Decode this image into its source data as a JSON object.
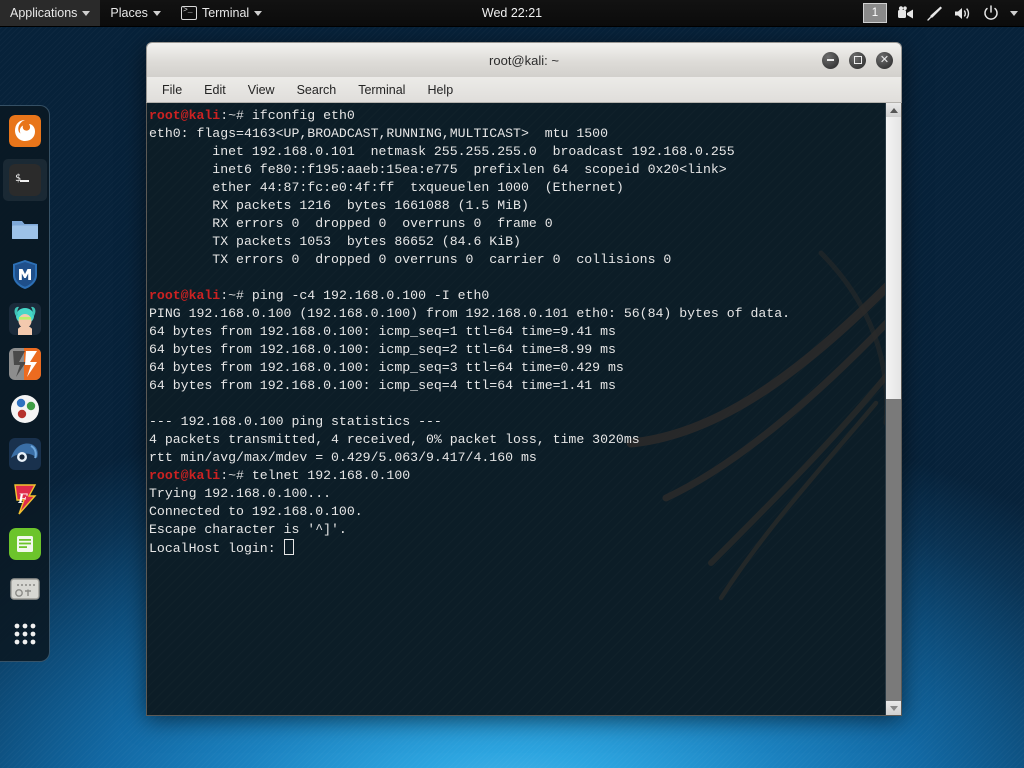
{
  "panel": {
    "applications_label": "Applications",
    "places_label": "Places",
    "terminal_label": "Terminal",
    "clock": "Wed 22:21",
    "workspace": "1",
    "tray": [
      {
        "name": "video-camera-icon"
      },
      {
        "name": "pen-icon"
      },
      {
        "name": "volume-icon"
      },
      {
        "name": "power-icon"
      },
      {
        "name": "chevron-down-icon"
      }
    ]
  },
  "dock": {
    "items": [
      {
        "name": "firefox-icon",
        "label": "Firefox ESR",
        "active": false
      },
      {
        "name": "terminal-icon",
        "label": "Terminal",
        "active": true
      },
      {
        "name": "files-icon",
        "label": "Files",
        "active": false
      },
      {
        "name": "metasploit-icon",
        "label": "Metasploit Framework",
        "active": false
      },
      {
        "name": "armitage-icon",
        "label": "Armitage",
        "active": false
      },
      {
        "name": "burpsuite-icon",
        "label": "Burp Suite",
        "active": false
      },
      {
        "name": "beef-icon",
        "label": "BeEF",
        "active": false
      },
      {
        "name": "maltego-icon",
        "label": "Maltego",
        "active": false
      },
      {
        "name": "faraday-icon",
        "label": "Faraday IDE",
        "active": false
      },
      {
        "name": "text-editor-icon",
        "label": "Text Editor",
        "active": false
      },
      {
        "name": "cherrytree-icon",
        "label": "CherryTree",
        "active": false
      },
      {
        "name": "show-applications-icon",
        "label": "Show Applications",
        "active": false
      }
    ]
  },
  "window": {
    "title": "root@kali: ~",
    "controls": {
      "minimize": "minimize",
      "maximize": "maximize",
      "close": "close"
    },
    "menu": [
      "File",
      "Edit",
      "View",
      "Search",
      "Terminal",
      "Help"
    ]
  },
  "terminal": {
    "prompt_user": "root@kali",
    "prompt_path": ":~# ",
    "colors": {
      "background": "#0c1d27",
      "foreground": "#e6e6e6",
      "prompt_red": "#cc2222"
    },
    "lines": [
      {
        "type": "prompt",
        "command": "ifconfig eth0"
      },
      {
        "type": "out",
        "text": "eth0: flags=4163<UP,BROADCAST,RUNNING,MULTICAST>  mtu 1500"
      },
      {
        "type": "out",
        "text": "        inet 192.168.0.101  netmask 255.255.255.0  broadcast 192.168.0.255"
      },
      {
        "type": "out",
        "text": "        inet6 fe80::f195:aaeb:15ea:e775  prefixlen 64  scopeid 0x20<link>"
      },
      {
        "type": "out",
        "text": "        ether 44:87:fc:e0:4f:ff  txqueuelen 1000  (Ethernet)"
      },
      {
        "type": "out",
        "text": "        RX packets 1216  bytes 1661088 (1.5 MiB)"
      },
      {
        "type": "out",
        "text": "        RX errors 0  dropped 0  overruns 0  frame 0"
      },
      {
        "type": "out",
        "text": "        TX packets 1053  bytes 86652 (84.6 KiB)"
      },
      {
        "type": "out",
        "text": "        TX errors 0  dropped 0 overruns 0  carrier 0  collisions 0"
      },
      {
        "type": "out",
        "text": ""
      },
      {
        "type": "prompt",
        "command": "ping -c4 192.168.0.100 -I eth0"
      },
      {
        "type": "out",
        "text": "PING 192.168.0.100 (192.168.0.100) from 192.168.0.101 eth0: 56(84) bytes of data."
      },
      {
        "type": "out",
        "text": "64 bytes from 192.168.0.100: icmp_seq=1 ttl=64 time=9.41 ms"
      },
      {
        "type": "out",
        "text": "64 bytes from 192.168.0.100: icmp_seq=2 ttl=64 time=8.99 ms"
      },
      {
        "type": "out",
        "text": "64 bytes from 192.168.0.100: icmp_seq=3 ttl=64 time=0.429 ms"
      },
      {
        "type": "out",
        "text": "64 bytes from 192.168.0.100: icmp_seq=4 ttl=64 time=1.41 ms"
      },
      {
        "type": "out",
        "text": ""
      },
      {
        "type": "out",
        "text": "--- 192.168.0.100 ping statistics ---"
      },
      {
        "type": "out",
        "text": "4 packets transmitted, 4 received, 0% packet loss, time 3020ms"
      },
      {
        "type": "out",
        "text": "rtt min/avg/max/mdev = 0.429/5.063/9.417/4.160 ms"
      },
      {
        "type": "prompt",
        "command": "telnet 192.168.0.100"
      },
      {
        "type": "out",
        "text": "Trying 192.168.0.100..."
      },
      {
        "type": "out",
        "text": "Connected to 192.168.0.100."
      },
      {
        "type": "out",
        "text": "Escape character is '^]'."
      },
      {
        "type": "cursor",
        "text": "LocalHost login: "
      }
    ]
  }
}
